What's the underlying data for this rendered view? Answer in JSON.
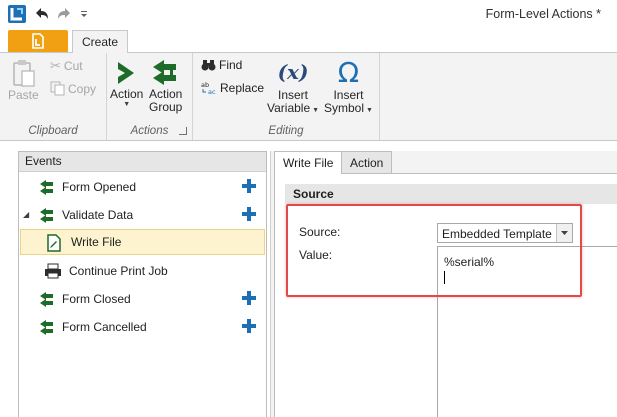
{
  "window": {
    "title": "Form-Level Actions *"
  },
  "ribbon_tabs": {
    "create": "Create"
  },
  "ribbon": {
    "clipboard": {
      "label": "Clipboard",
      "paste": "Paste",
      "cut": "Cut",
      "copy": "Copy"
    },
    "actions": {
      "label": "Actions",
      "action_line1": "Action",
      "action_group_line1": "Action",
      "action_group_line2": "Group"
    },
    "editing": {
      "label": "Editing",
      "find": "Find",
      "replace": "Replace",
      "insert_variable_line1": "Insert",
      "insert_variable_line2": "Variable",
      "insert_symbol_line1": "Insert",
      "insert_symbol_line2": "Symbol",
      "variable_glyph": "(x)",
      "symbol_glyph": "Ω"
    }
  },
  "events": {
    "header": "Events",
    "items": [
      {
        "label": "Form Opened",
        "icon": "action-group-icon",
        "addable": true
      },
      {
        "label": "Validate Data",
        "icon": "action-group-icon",
        "addable": true,
        "expanded": true
      },
      {
        "label": "Write File",
        "icon": "write-file-icon",
        "selected": true
      },
      {
        "label": "Continue Print Job",
        "icon": "printer-icon"
      },
      {
        "label": "Form Closed",
        "icon": "action-group-icon",
        "addable": true
      },
      {
        "label": "Form Cancelled",
        "icon": "action-group-icon",
        "addable": true
      }
    ]
  },
  "detail": {
    "tabs": [
      "Write File",
      "Action"
    ],
    "section_header": "Source",
    "source_label": "Source:",
    "source_value": "Embedded Template",
    "value_label": "Value:",
    "value_text": "%serial%"
  },
  "colors": {
    "accent_orange": "#f0a012",
    "brand_green": "#1e6b2a",
    "brand_blue": "#1f6fb5",
    "highlight_red": "#e14a4a",
    "selection_bg": "#fdf3cf"
  }
}
